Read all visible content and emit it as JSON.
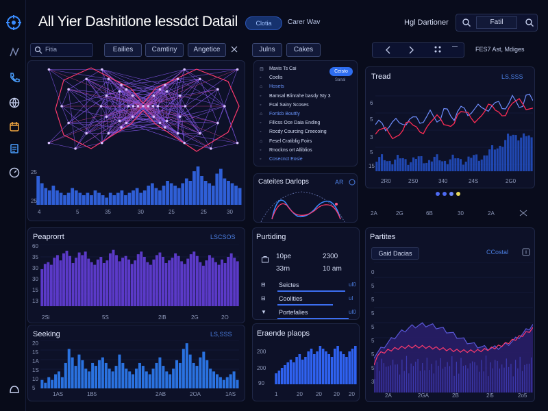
{
  "header": {
    "title": "All Yier Dashitlone lessdct Datail",
    "pill_active": "Clotia",
    "pill_other": "Carer Wav",
    "right_label": "Hgl Dartioner",
    "right_button": "Fatil"
  },
  "toolbar": {
    "search_placeholder": "Fitia",
    "filters": [
      "Eailies",
      "Camtiny",
      "Angetice"
    ],
    "mid_buttons": [
      "Julns",
      "Cakes"
    ],
    "right_text": "FES7 Ast, Mdiges"
  },
  "network_panel": {
    "x_ticks": [
      "4",
      "5",
      "35",
      "30",
      "25",
      "25",
      "30"
    ],
    "y_ticks": [
      "25",
      "25"
    ],
    "histogram": [
      12,
      9,
      7,
      6,
      8,
      6,
      5,
      4,
      5,
      7,
      6,
      5,
      4,
      5,
      4,
      6,
      5,
      4,
      3,
      5,
      4,
      5,
      6,
      4,
      5,
      6,
      7,
      5,
      6,
      8,
      9,
      7,
      6,
      8,
      10,
      9,
      8,
      7,
      9,
      11,
      10,
      14,
      16,
      12,
      10,
      9,
      8,
      13,
      15,
      11,
      10,
      9,
      8,
      7
    ]
  },
  "list_panel": {
    "badge": "Ceisto",
    "badge_sub": "Sanal",
    "items": [
      "Mavis Ts Cai",
      "Coelis",
      "Hosets",
      "Bamsal Blinrahe basdy Sty 3",
      "Fsal Sainy Scoses",
      "Forticb Bouttly",
      "Fillcss Oce Daia Ending",
      "Rocdy Courcing Creecoing",
      "Fesel Cratiblig Foirs",
      "Rnockns ort Alliblios",
      "Cosecnct Eosie"
    ]
  },
  "curves_panel": {
    "title": "Cateites Darlops",
    "meta": "AR"
  },
  "trend_panel": {
    "title": "Tread",
    "meta": "LS,SSS",
    "y_ticks": [
      "6",
      "5",
      "3",
      "5",
      "15"
    ],
    "x_ticks": [
      "2R0",
      "2S0",
      "340",
      "24S",
      "2G0"
    ],
    "x_ticks_2": [
      "2A",
      "2G",
      "6B",
      "30",
      "2A"
    ],
    "dot_colors": [
      "#4d6af2",
      "#4d6af2",
      "#6e8bff",
      "#e6d85a"
    ]
  },
  "perf_panel": {
    "title": "Peaprorrt",
    "meta": "LSCSOS",
    "y_ticks": [
      "60",
      "35",
      "30",
      "30",
      "15",
      "13"
    ],
    "x_ticks": [
      "2Si",
      "5S",
      "2lB",
      "2G",
      "2O"
    ],
    "bars": [
      42,
      48,
      50,
      47,
      55,
      58,
      52,
      60,
      63,
      57,
      49,
      55,
      61,
      58,
      62,
      54,
      50,
      47,
      53,
      56,
      49,
      52,
      60,
      64,
      58,
      51,
      55,
      57,
      53,
      48,
      52,
      59,
      62,
      56,
      50,
      47,
      53,
      58,
      61,
      56,
      49,
      52,
      55,
      60,
      57,
      51,
      48,
      54,
      59,
      62,
      57,
      50,
      46,
      52,
      58,
      55,
      50,
      47,
      53,
      49,
      56,
      60,
      55,
      51
    ]
  },
  "parting_panel": {
    "title": "Purtiding",
    "stats": [
      [
        "10pe",
        "2300"
      ],
      [
        "33rn",
        "10 am"
      ]
    ],
    "rows": [
      {
        "label": "Seictes",
        "value": "ul0",
        "fill": 0.85
      },
      {
        "label": "Coolities",
        "value": "ul",
        "fill": 0.7
      },
      {
        "label": "Portefalies",
        "value": "ul0",
        "fill": 0.9
      }
    ]
  },
  "particles_panel": {
    "title": "Partites",
    "tab_left": "Gaid Dacias",
    "tab_right": "CCostal",
    "y_ticks": [
      "0",
      "5",
      "5",
      "5",
      "5",
      "5",
      "5",
      "5",
      "3"
    ],
    "x_ticks": [
      "2A",
      "2GA",
      "2B",
      "2l5",
      "2o5"
    ]
  },
  "seeking_panel": {
    "title": "Seeking",
    "meta": "LS,SSS",
    "y_ticks": [
      "20",
      "15",
      "1A",
      "1S",
      "10",
      "5"
    ],
    "x_ticks": [
      "1AS",
      "1B5",
      "2AB",
      "2OA",
      "1AS"
    ],
    "bars": [
      3,
      2,
      4,
      3,
      5,
      6,
      4,
      9,
      14,
      11,
      8,
      12,
      10,
      7,
      6,
      9,
      8,
      10,
      11,
      9,
      7,
      6,
      8,
      12,
      9,
      7,
      6,
      5,
      7,
      9,
      8,
      6,
      5,
      7,
      9,
      11,
      8,
      6,
      5,
      7,
      10,
      9,
      14,
      16,
      12,
      9,
      8,
      11,
      13,
      10,
      7,
      6,
      5,
      4,
      3,
      4,
      5,
      6,
      3
    ]
  },
  "pricing_panel": {
    "title": "Eraende plaops",
    "y_ticks": [
      "200",
      "200",
      "90"
    ],
    "x_ticks": [
      "1",
      "20",
      "20",
      "20",
      "20"
    ],
    "bars": [
      4,
      5,
      6,
      7,
      8,
      9,
      8,
      10,
      11,
      9,
      10,
      12,
      13,
      11,
      12,
      14,
      13,
      12,
      11,
      10,
      13,
      14,
      12,
      11,
      10,
      12,
      13,
      14
    ]
  }
}
